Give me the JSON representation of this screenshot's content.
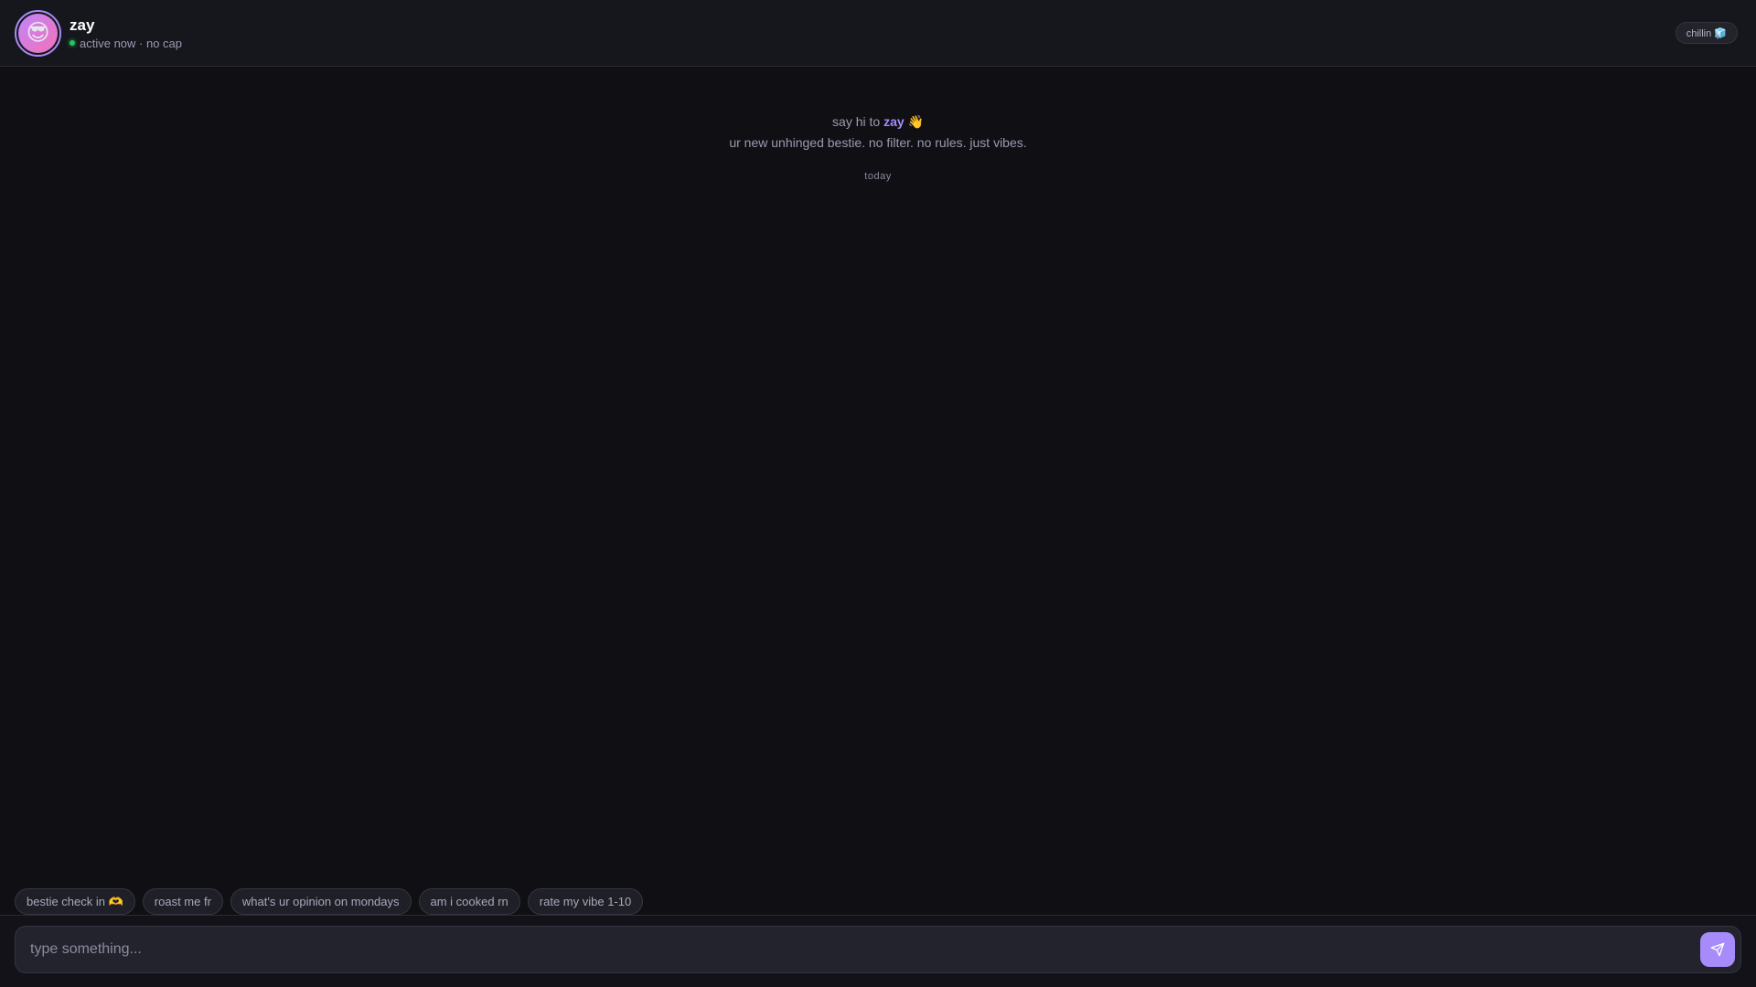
{
  "header": {
    "avatar_emoji": "😎",
    "name": "zay",
    "status": "active now · no cap",
    "mood_badge": "chillin 🧊"
  },
  "intro": {
    "prefix": "say hi to ",
    "name": "zay",
    "suffix": " 👋",
    "subtitle": "ur new unhinged bestie. no filter. no rules. just vibes."
  },
  "date_divider": "today",
  "suggestions": [
    {
      "label": "bestie check in 🫶"
    },
    {
      "label": "roast me fr"
    },
    {
      "label": "what's ur opinion on mondays"
    },
    {
      "label": "am i cooked rn"
    },
    {
      "label": "rate my vibe 1-10"
    }
  ],
  "composer": {
    "placeholder": "type something...",
    "value": ""
  },
  "colors": {
    "accent": "#a78bfa",
    "online": "#22c55e",
    "background": "#0f0f14"
  },
  "icons": {
    "send": "send-icon"
  }
}
